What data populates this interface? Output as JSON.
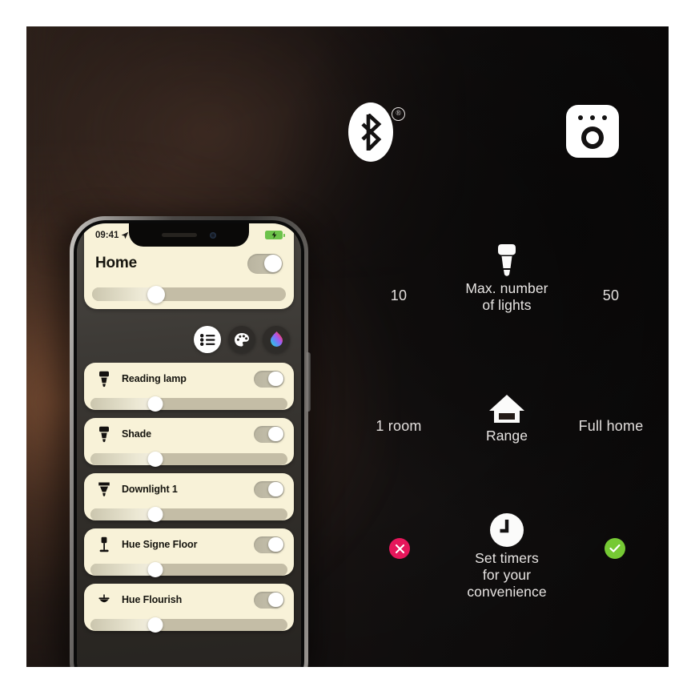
{
  "background": {
    "accent_warm": "#be764a",
    "base_dark": "#0e0c0c"
  },
  "top_icons": [
    {
      "name": "bluetooth-icon",
      "registered_mark": "®"
    },
    {
      "name": "hue-bridge-icon"
    }
  ],
  "comparison": {
    "rows": [
      {
        "id": "max-lights",
        "icon": "bulb-icon",
        "label": "Max. number\nof lights",
        "left_value": "10",
        "right_value": "50"
      },
      {
        "id": "range",
        "icon": "house-icon",
        "label": "Range",
        "left_value": "1 room",
        "right_value": "Full home"
      },
      {
        "id": "timers",
        "icon": "clock-icon",
        "label": "Set timers\nfor your\nconvenience",
        "left_value": "✕",
        "right_value": "✓",
        "left_badge_color": "#e6175b",
        "right_badge_color": "#76c934"
      }
    ]
  },
  "phone": {
    "status_bar": {
      "time": "09:41",
      "location_icon": "location-arrow-icon",
      "battery_icon": "battery-charging-icon",
      "battery_color": "#6cc24a"
    },
    "home_card": {
      "title": "Home",
      "toggle_on": true,
      "brightness_percent": 33
    },
    "mode_buttons": [
      {
        "name": "list-view-button",
        "icon": "list-icon",
        "active": true
      },
      {
        "name": "scenes-button",
        "icon": "palette-icon",
        "active": false
      },
      {
        "name": "color-button",
        "icon": "color-drop-icon",
        "active": false
      }
    ],
    "lights": [
      {
        "name": "Reading lamp",
        "icon": "bulb-icon",
        "toggle_on": true,
        "brightness_percent": 33
      },
      {
        "name": "Shade",
        "icon": "bulb-icon",
        "toggle_on": true,
        "brightness_percent": 33
      },
      {
        "name": "Downlight 1",
        "icon": "downlight-icon",
        "toggle_on": true,
        "brightness_percent": 33
      },
      {
        "name": "Hue Signe Floor",
        "icon": "floorlamp-icon",
        "toggle_on": true,
        "brightness_percent": 33
      },
      {
        "name": "Hue Flourish",
        "icon": "pendant-icon",
        "toggle_on": true,
        "brightness_percent": 33
      }
    ]
  }
}
